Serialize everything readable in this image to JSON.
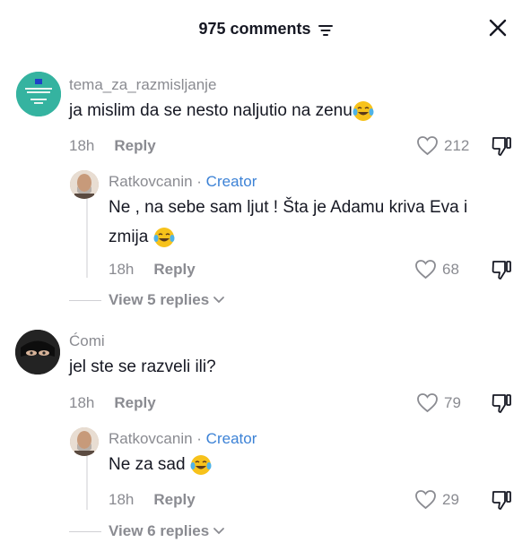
{
  "header": {
    "title": "975 comments",
    "sort_icon": "filter-lines-icon",
    "close_icon": "close-icon"
  },
  "comments": [
    {
      "username": "tema_za_razmisljanje",
      "text": "ja mislim da se nesto naljutio na zenu",
      "emoji": "tears-of-joy-emoji",
      "time": "18h",
      "reply_label": "Reply",
      "likes": "212",
      "avatar_colors": {
        "bg": "#35b3a0",
        "accent": "#1e40c8"
      },
      "reply": {
        "username": "Ratkovcanin",
        "separator": " · ",
        "badge": "Creator",
        "text_line1": "Ne , na sebe sam ljut ! Šta je Adamu kriva Eva i",
        "text_line2": "zmija",
        "emoji": "tears-of-joy-emoji",
        "time": "18h",
        "reply_label": "Reply",
        "likes": "68"
      },
      "view_replies": "View 5 replies"
    },
    {
      "username": "Ćomi",
      "text": "jel ste se razveli ili?",
      "time": "18h",
      "reply_label": "Reply",
      "likes": "79",
      "reply": {
        "username": "Ratkovcanin",
        "separator": " · ",
        "badge": "Creator",
        "text_line1": "Ne za sad",
        "emoji": "tears-of-joy-emoji",
        "time": "18h",
        "reply_label": "Reply",
        "likes": "29"
      },
      "view_replies": "View 6 replies"
    }
  ],
  "colors": {
    "text": "#161823",
    "muted": "#8a8b91",
    "creator": "#3c82d6"
  }
}
